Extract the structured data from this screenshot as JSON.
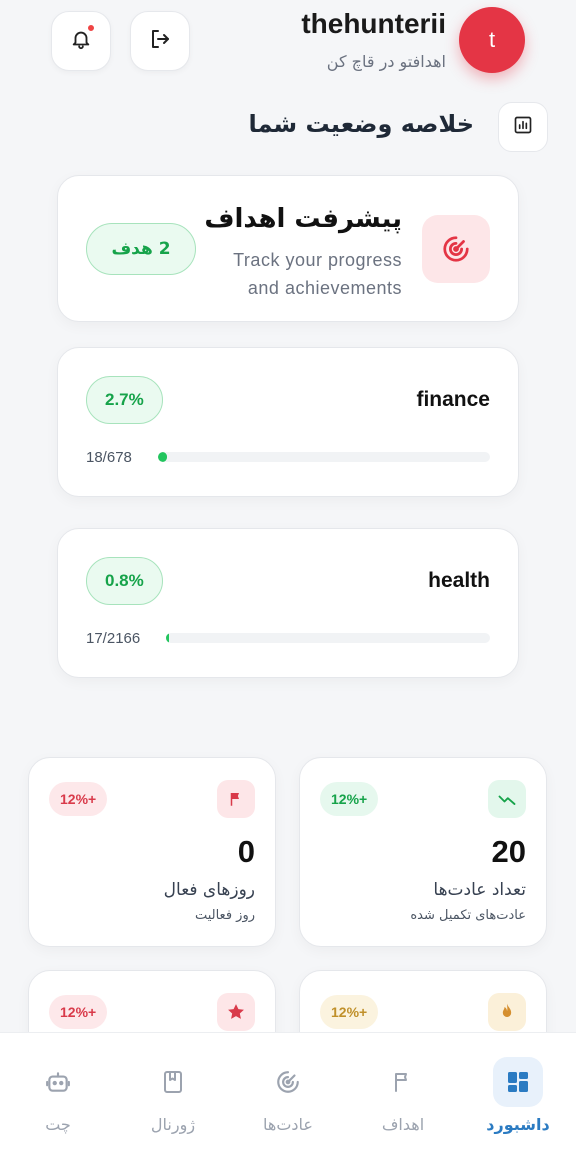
{
  "header": {
    "username": "thehunterii",
    "subtitle": "اهدافتو در قاچ کن",
    "avatar_initial": "t",
    "avatar_color": "#e43545",
    "has_notification": true
  },
  "summary": {
    "title": "خلاصه وضعیت شما"
  },
  "goal_progress": {
    "title": "پیشرفت اهداف",
    "description": "Track your progress and achievements",
    "count_badge": "2 هدف"
  },
  "goals": [
    {
      "name": "finance",
      "percent_label": "2.7%",
      "fraction": "18/678",
      "progress": 0.027
    },
    {
      "name": "health",
      "percent_label": "0.8%",
      "fraction": "17/2166",
      "progress": 0.008
    }
  ],
  "stats": [
    {
      "value": "0",
      "label": "روزهای فعال",
      "sublabel": "روز فعالیت",
      "trend": "12%+",
      "icon": "flag-icon",
      "accent": "#d93a4a"
    },
    {
      "value": "20",
      "label": "تعداد عادت‌ها",
      "sublabel": "عادت‌های تکمیل شده",
      "trend": "12%+",
      "icon": "trend-icon",
      "accent": "#16a34a"
    },
    {
      "value": "",
      "label": "",
      "sublabel": "",
      "trend": "12%+",
      "icon": "star-icon",
      "accent": "#d93a4a"
    },
    {
      "value": "",
      "label": "",
      "sublabel": "",
      "trend": "12%+",
      "icon": "fire-icon",
      "accent": "#c0902a"
    }
  ],
  "nav": [
    {
      "label": "داشبورد",
      "icon": "dashboard-icon",
      "active": true
    },
    {
      "label": "اهداف",
      "icon": "flag-icon",
      "active": false
    },
    {
      "label": "عادت‌ها",
      "icon": "target-icon",
      "active": false
    },
    {
      "label": "ژورنال",
      "icon": "book-icon",
      "active": false
    },
    {
      "label": "چت",
      "icon": "bot-icon",
      "active": false
    }
  ]
}
